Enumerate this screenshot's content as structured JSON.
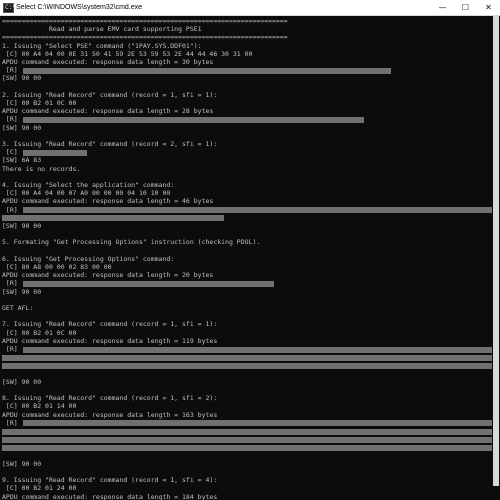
{
  "window": {
    "title": "Select C:\\WINDOWS\\system32\\cmd.exe",
    "icon_label": "C:\\",
    "controls": {
      "minimize": "—",
      "maximize": "☐",
      "close": "✕"
    }
  },
  "console_lines": [
    {
      "t": "========================================================================="
    },
    {
      "t": "            Read and parse EMV card supporting PSE1"
    },
    {
      "t": "========================================================================="
    },
    {
      "t": "1. Issuing \"Select PSE\" command (\"1PAY.SYS.DDF01\"):"
    },
    {
      "t": " [C] 00 A4 04 00 0E 31 50 41 59 2E 53 59 53 2E 44 44 46 30 31 00"
    },
    {
      "t": "APDU command executed: response data length = 30 bytes"
    },
    {
      "t": " [R] ",
      "r": [
        [
          21,
          389
        ]
      ]
    },
    {
      "t": "[SW] 90 00"
    },
    {
      "t": ""
    },
    {
      "t": "2. Issuing \"Read Record\" command (record = 1, sfi = 1):"
    },
    {
      "t": " [C] 00 B2 01 0C 00"
    },
    {
      "t": "APDU command executed: response data length = 28 bytes"
    },
    {
      "t": " [R] ",
      "r": [
        [
          21,
          362
        ]
      ]
    },
    {
      "t": "[SW] 90 00"
    },
    {
      "t": ""
    },
    {
      "t": "3. Issuing \"Read Record\" command (record = 2, sfi = 1):"
    },
    {
      "t": " [C] ",
      "r": [
        [
          21,
          85
        ]
      ]
    },
    {
      "t": "[SW] 6A 83"
    },
    {
      "t": "There is no records."
    },
    {
      "t": ""
    },
    {
      "t": "4. Issuing \"Select the application\" command:"
    },
    {
      "t": " [C] 00 A4 04 00 07 A0 00 00 00 04 10 10 00"
    },
    {
      "t": "APDU command executed: response data length = 46 bytes"
    },
    {
      "t": " [R] ",
      "r": [
        [
          21,
          490
        ]
      ]
    },
    {
      "t": "",
      "r": [
        [
          0,
          222
        ]
      ]
    },
    {
      "t": "[SW] 90 00"
    },
    {
      "t": ""
    },
    {
      "t": "5. Formating \"Get Processing Options\" instruction (checking PDOL)."
    },
    {
      "t": ""
    },
    {
      "t": "6. Issuing \"Get Processing Options\" command:"
    },
    {
      "t": " [C] 80 A8 00 00 02 83 00 00"
    },
    {
      "t": "APDU command executed: response data length = 20 bytes"
    },
    {
      "t": " [R] ",
      "r": [
        [
          21,
          272
        ]
      ]
    },
    {
      "t": "[SW] 90 00"
    },
    {
      "t": ""
    },
    {
      "t": "GET AFL:"
    },
    {
      "t": ""
    },
    {
      "t": "7. Issuing \"Read Record\" command (record = 1, sfi = 1):"
    },
    {
      "t": " [C] 00 B2 01 0C 00"
    },
    {
      "t": "APDU command executed: response data length = 119 bytes"
    },
    {
      "t": " [R] ",
      "r": [
        [
          21,
          490
        ]
      ]
    },
    {
      "t": "",
      "r": [
        [
          0,
          490
        ]
      ]
    },
    {
      "t": "",
      "r": [
        [
          0,
          490
        ]
      ]
    },
    {
      "t": ""
    },
    {
      "t": "[SW] 90 00"
    },
    {
      "t": ""
    },
    {
      "t": "8. Issuing \"Read Record\" command (record = 1, sfi = 2):"
    },
    {
      "t": " [C] 00 B2 01 14 00"
    },
    {
      "t": "APDU command executed: response data length = 163 bytes"
    },
    {
      "t": " [R] ",
      "r": [
        [
          21,
          490
        ]
      ]
    },
    {
      "t": "",
      "r": [
        [
          0,
          490
        ]
      ]
    },
    {
      "t": "",
      "r": [
        [
          0,
          490
        ]
      ]
    },
    {
      "t": "",
      "r": [
        [
          0,
          490
        ]
      ]
    },
    {
      "t": ""
    },
    {
      "t": "[SW] 90 00"
    },
    {
      "t": ""
    },
    {
      "t": "9. Issuing \"Read Record\" command (record = 1, sfi = 4):"
    },
    {
      "t": " [C] 00 B2 01 24 00"
    },
    {
      "t": "APDU command executed: response data length = 184 bytes"
    },
    {
      "t": " [R] ",
      "r": [
        [
          21,
          490
        ]
      ]
    }
  ]
}
